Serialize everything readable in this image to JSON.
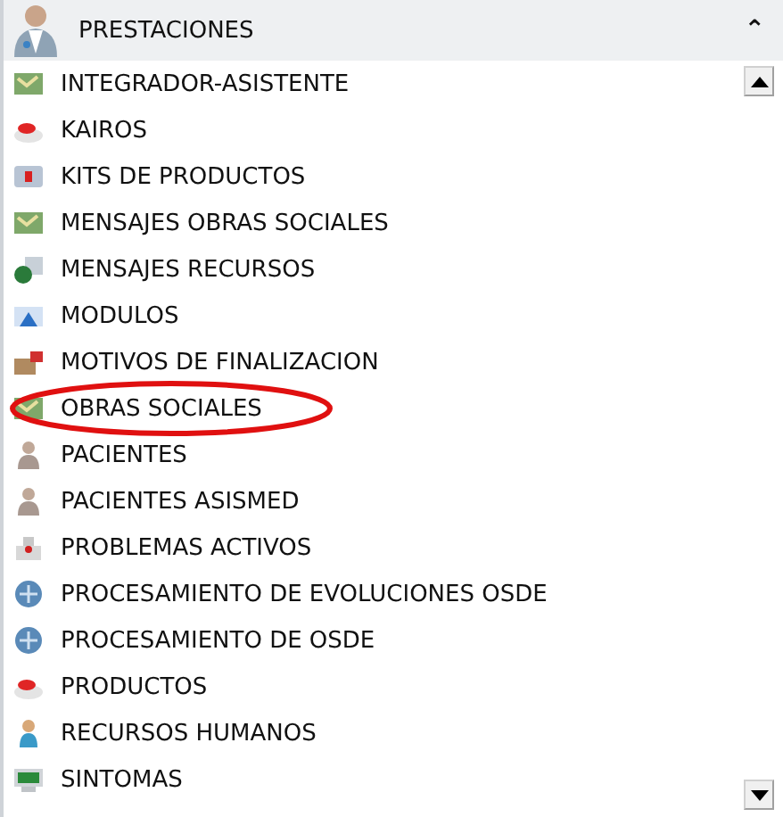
{
  "panel": {
    "title": "PRESTACIONES",
    "collapse_glyph": "⌃"
  },
  "items": [
    {
      "label": "INTEGRADOR-ASISTENTE",
      "circled": false
    },
    {
      "label": "KAIROS",
      "circled": false
    },
    {
      "label": "KITS DE PRODUCTOS",
      "circled": false
    },
    {
      "label": "MENSAJES OBRAS SOCIALES",
      "circled": false
    },
    {
      "label": "MENSAJES RECURSOS",
      "circled": false
    },
    {
      "label": "MODULOS",
      "circled": false
    },
    {
      "label": "MOTIVOS DE FINALIZACION",
      "circled": false
    },
    {
      "label": "OBRAS SOCIALES",
      "circled": true
    },
    {
      "label": "PACIENTES",
      "circled": false
    },
    {
      "label": "PACIENTES ASISMED",
      "circled": false
    },
    {
      "label": "PROBLEMAS ACTIVOS",
      "circled": false
    },
    {
      "label": "PROCESAMIENTO DE EVOLUCIONES OSDE",
      "circled": false
    },
    {
      "label": "PROCESAMIENTO DE OSDE",
      "circled": false
    },
    {
      "label": "PRODUCTOS",
      "circled": false
    },
    {
      "label": "RECURSOS HUMANOS",
      "circled": false
    },
    {
      "label": "SINTOMAS",
      "circled": false
    }
  ]
}
